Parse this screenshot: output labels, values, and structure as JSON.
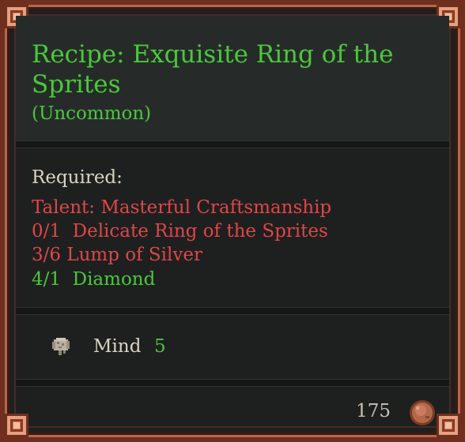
{
  "tooltip": {
    "title": "Recipe: Exquisite Ring of the Sprites",
    "rarity": "(Uncommon)",
    "required_heading": "Required:",
    "requirements": [
      {
        "text": "Talent: Masterful Craftsmanship",
        "status": "missing"
      },
      {
        "text": "0/1  Delicate Ring of the Sprites",
        "status": "missing"
      },
      {
        "text": "3/6 Lump of Silver",
        "status": "missing"
      },
      {
        "text": "4/1  Diamond",
        "status": "met"
      }
    ],
    "stat": {
      "icon": "brain-icon",
      "label": "Mind",
      "value": "5"
    },
    "price": {
      "value": "175",
      "icon": "copper-coin-icon"
    }
  },
  "colors": {
    "uncommon_green": "#4ac93a",
    "missing_red": "#e04646",
    "frame_copper": "#b8664a"
  }
}
